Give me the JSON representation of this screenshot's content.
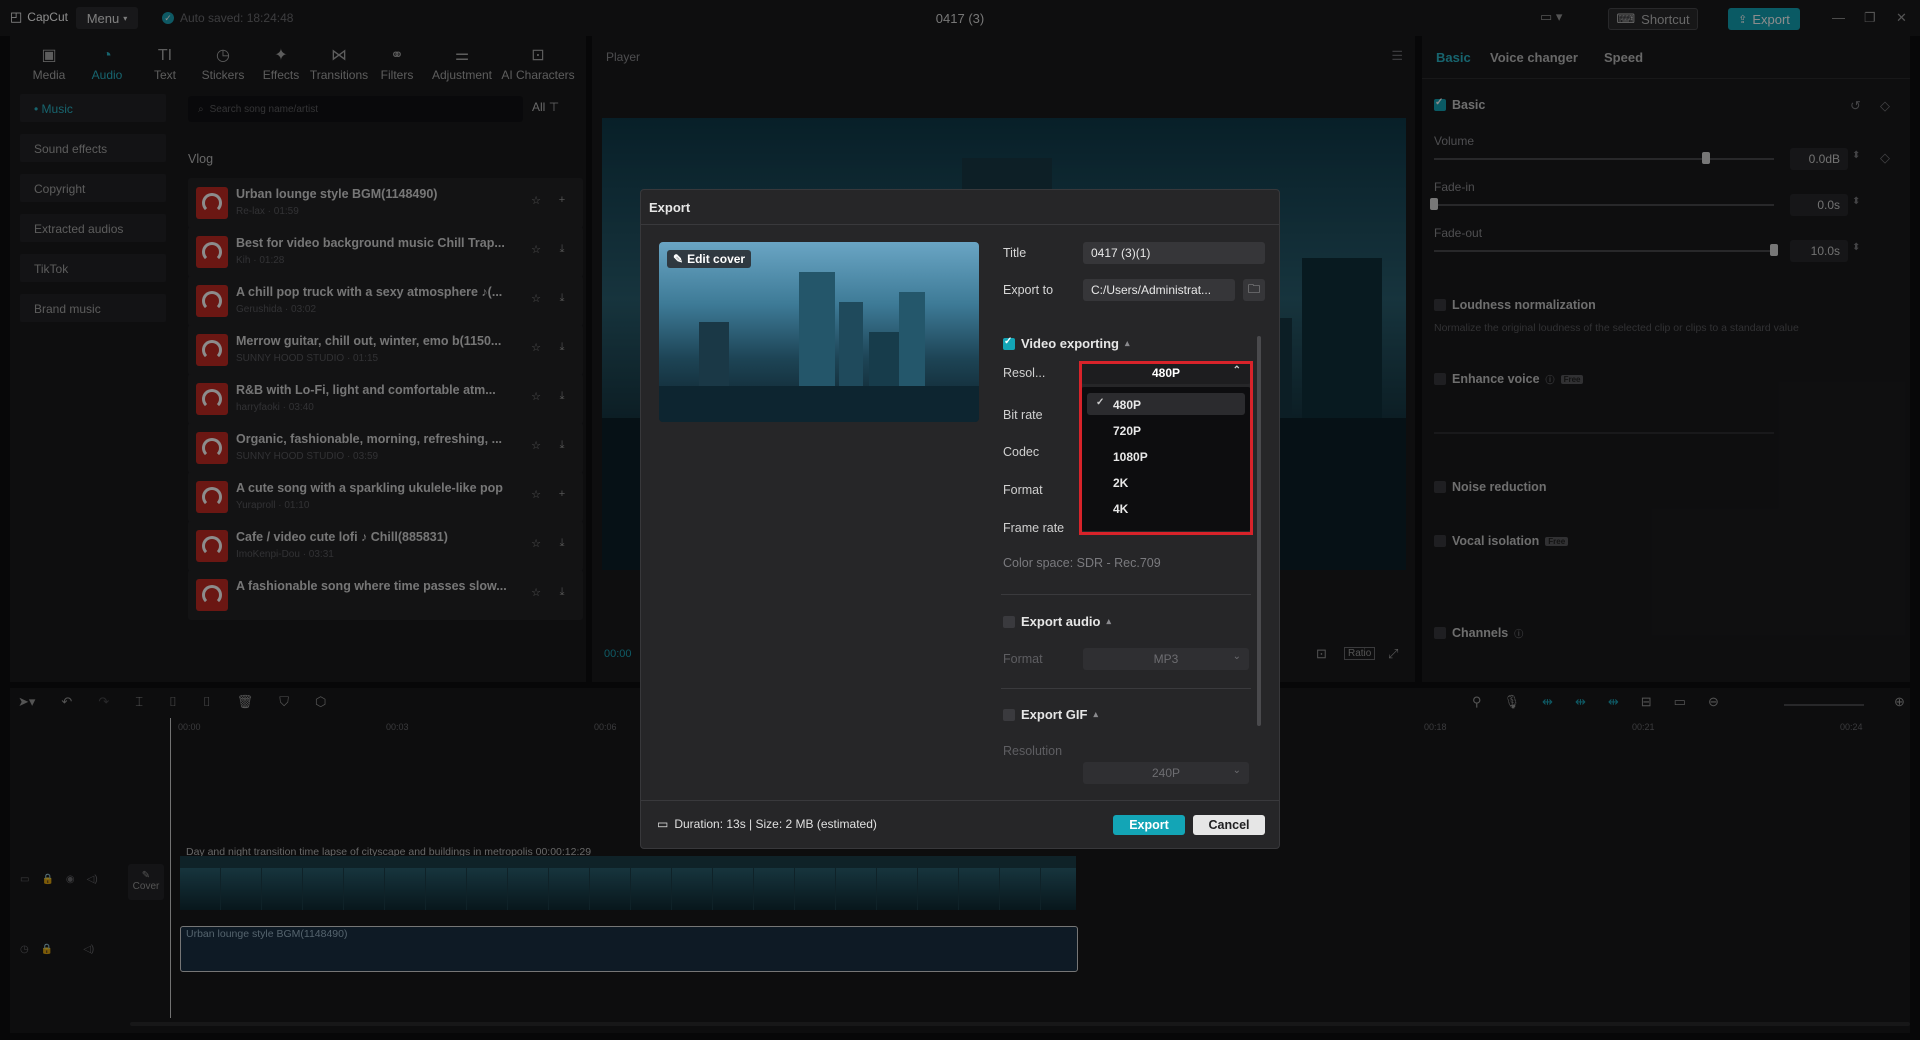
{
  "app": {
    "logo_text": "CapCut",
    "menu_label": "Menu",
    "autosave_text": "Auto saved: 18:24:48",
    "project_title": "0417 (3)",
    "shortcut_label": "Shortcut",
    "export_label": "Export"
  },
  "toolbar_tabs": [
    {
      "label": "Media",
      "icon": "media-icon"
    },
    {
      "label": "Audio",
      "icon": "audio-icon"
    },
    {
      "label": "Text",
      "icon": "text-icon"
    },
    {
      "label": "Stickers",
      "icon": "stickers-icon"
    },
    {
      "label": "Effects",
      "icon": "effects-icon"
    },
    {
      "label": "Transitions",
      "icon": "transitions-icon"
    },
    {
      "label": "Filters",
      "icon": "filters-icon"
    },
    {
      "label": "Adjustment",
      "icon": "adjustment-icon"
    },
    {
      "label": "AI Characters",
      "icon": "ai-characters-icon"
    }
  ],
  "audio_categories": [
    "• Music",
    "Sound effects",
    "Copyright",
    "Extracted audios",
    "TikTok",
    "Brand music"
  ],
  "search": {
    "placeholder": "Search song name/artist",
    "filter_label": "All"
  },
  "section_label": "Vlog",
  "songs": [
    {
      "title": "Urban lounge style BGM(1148490)",
      "meta": "Re-lax · 01:59"
    },
    {
      "title": "Best for video background music Chill Trap...",
      "meta": "Kih · 01:28"
    },
    {
      "title": "A chill pop truck with a sexy atmosphere ♪(...",
      "meta": "Gerushida · 03:02"
    },
    {
      "title": "Merrow guitar, chill out, winter, emo b(1150...",
      "meta": "SUNNY HOOD STUDIO · 01:15"
    },
    {
      "title": "R&B with Lo-Fi, light and comfortable atm...",
      "meta": "harryfaoki · 03:40"
    },
    {
      "title": "Organic, fashionable, morning, refreshing, ...",
      "meta": "SUNNY HOOD STUDIO · 03:59"
    },
    {
      "title": "A cute song with a sparkling ukulele-like pop",
      "meta": "Yuraproll · 01:10"
    },
    {
      "title": "Cafe / video cute lofi ♪ Chill(885831)",
      "meta": "ImoKenpi-Dou · 03:31"
    },
    {
      "title": "A fashionable song where time passes slow...",
      "meta": ""
    }
  ],
  "player": {
    "label": "Player",
    "timecode": "00:00",
    "ratio_label": "Ratio"
  },
  "right_panel": {
    "tabs": [
      "Basic",
      "Voice changer",
      "Speed"
    ],
    "basic_label": "Basic",
    "volume_label": "Volume",
    "volume_value": "0.0dB",
    "volume_level": 0.8,
    "fadein_label": "Fade-in",
    "fadein_value": "0.0s",
    "fadein_level": 0.0,
    "fadeout_label": "Fade-out",
    "fadeout_value": "10.0s",
    "fadeout_level": 1.0,
    "loudness_label": "Loudness normalization",
    "loudness_desc": "Normalize the original loudness of the selected clip or clips to a standard value",
    "enhance_label": "Enhance voice",
    "noise_label": "Noise reduction",
    "vocal_label": "Vocal isolation",
    "channels_label": "Channels",
    "badge_free": "Free"
  },
  "timeline": {
    "ticks": [
      "00:00",
      "00:03",
      "00:06",
      "00:18",
      "00:21",
      "00:24"
    ],
    "video_clip_label": "Day and night transition time lapse of cityscape and buildings in metropolis  00:00:12:29",
    "audio_clip_label": "Urban lounge style BGM(1148490)",
    "cover_label": "Cover"
  },
  "export_dialog": {
    "title": "Export",
    "edit_cover_label": "Edit cover",
    "title_label": "Title",
    "title_value": "0417 (3)(1)",
    "export_to_label": "Export to",
    "export_to_value": "C:/Users/Administrat...",
    "video_section": "Video exporting",
    "resolution_label": "Resol...",
    "resolution_value": "480P",
    "bitrate_label": "Bit rate",
    "codec_label": "Codec",
    "format_label": "Format",
    "framerate_label": "Frame rate",
    "colorspace_label": "Color space: SDR - Rec.709",
    "resolution_options": [
      "480P",
      "720P",
      "1080P",
      "2K",
      "4K"
    ],
    "audio_section": "Export audio",
    "audio_format_label": "Format",
    "audio_format_value": "MP3",
    "gif_section": "Export GIF",
    "gif_resolution_label": "Resolution",
    "gif_resolution_value": "240P",
    "footer_info": "Duration: 13s | Size: 2 MB (estimated)",
    "export_btn": "Export",
    "cancel_btn": "Cancel"
  },
  "colors": {
    "accent": "#13a5b6",
    "highlight": "#d8232a"
  }
}
